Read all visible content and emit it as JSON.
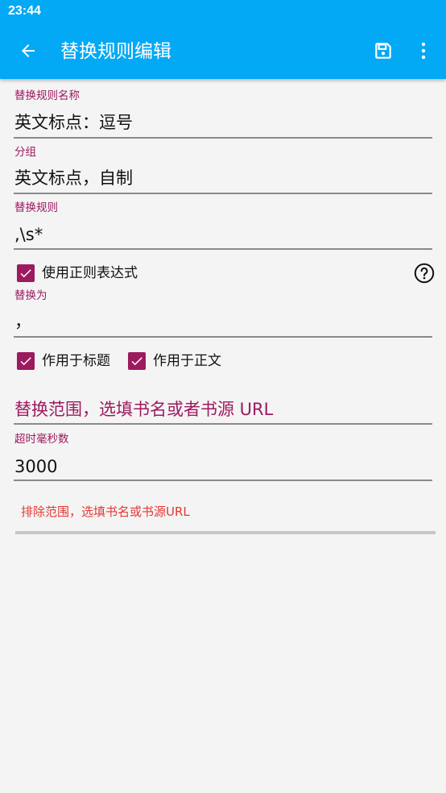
{
  "status_bar": {
    "time": "23:44"
  },
  "app_bar": {
    "title": "替换规则编辑",
    "background_color": "#03a9f4",
    "icons": [
      "back-arrow-icon",
      "save-icon",
      "more-vertical-icon"
    ]
  },
  "form": {
    "name": {
      "label": "替换规则名称",
      "value": "英文标点：逗号"
    },
    "group": {
      "label": "分组",
      "value": "英文标点，自制"
    },
    "pattern": {
      "label": "替换规则",
      "value": ",\\s*"
    },
    "use_regex": {
      "label": "使用正则表达式",
      "checked": true
    },
    "replacement": {
      "label": "替换为",
      "value": "，"
    },
    "apply_title": {
      "label": "作用于标题",
      "checked": true
    },
    "apply_content": {
      "label": "作用于正文",
      "checked": true
    },
    "scope": {
      "placeholder": "替换范围，选填书名或者书源 URL"
    },
    "timeout": {
      "label": "超时毫秒数",
      "value": "3000"
    },
    "exclude": {
      "placeholder": "排除范围，选填书名或书源URL"
    }
  },
  "colors": {
    "accent": "#9c1a5f",
    "error_hint": "#e53935",
    "background": "#f4f4f4"
  }
}
